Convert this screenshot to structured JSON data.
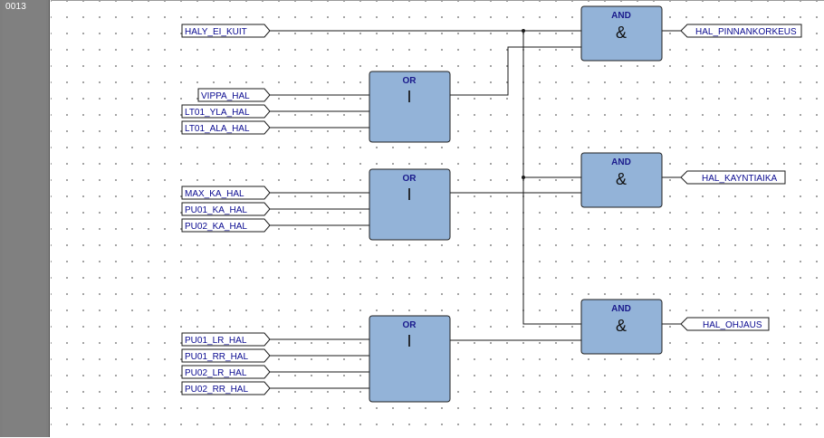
{
  "rung": {
    "number": "0013"
  },
  "colors": {
    "block_fill": "#93b3d8",
    "pin_text": "#0a0a90",
    "rung_bar": "#7e7e7e"
  },
  "blocks": [
    {
      "id": "or1",
      "type": "OR",
      "symbol": "I"
    },
    {
      "id": "or2",
      "type": "OR",
      "symbol": "I"
    },
    {
      "id": "or3",
      "type": "OR",
      "symbol": "I"
    },
    {
      "id": "and1",
      "type": "AND",
      "symbol": "&"
    },
    {
      "id": "and2",
      "type": "AND",
      "symbol": "&"
    },
    {
      "id": "and3",
      "type": "AND",
      "symbol": "&"
    }
  ],
  "inputs": [
    "HALY_EI_KUIT",
    "VIPPA_HAL",
    "LT01_YLA_HAL",
    "LT01_ALA_HAL",
    "MAX_KA_HAL",
    "PU01_KA_HAL",
    "PU02_KA_HAL",
    "PU01_LR_HAL",
    "PU01_RR_HAL",
    "PU02_LR_HAL",
    "PU02_RR_HAL"
  ],
  "outputs": [
    "HAL_PINNANKORKEUS",
    "HAL_KAYNTIAIKA",
    "HAL_OHJAUS"
  ]
}
